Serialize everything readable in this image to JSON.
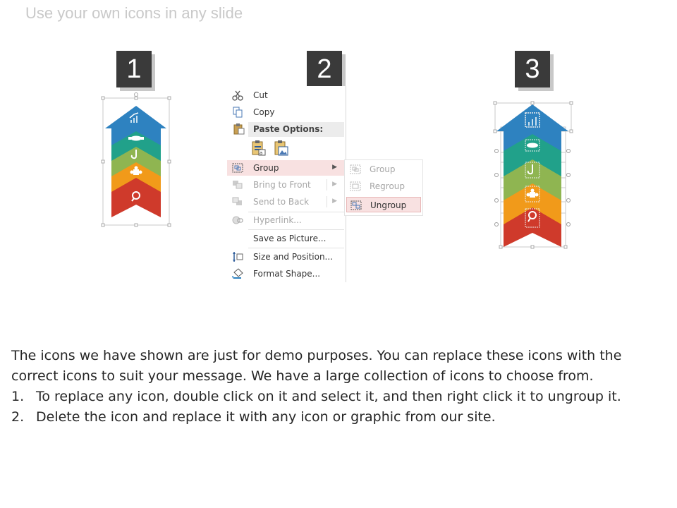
{
  "slide": {
    "title": "Use your own icons in any slide"
  },
  "steps": [
    "1",
    "2",
    "3"
  ],
  "arrow_colors": [
    "#2e82c0",
    "#21a18a",
    "#8fb551",
    "#f19a1a",
    "#cf3a2b"
  ],
  "arrow_icons": [
    "chart-growth-icon",
    "handshake-icon",
    "hook-icon",
    "puzzle-icon",
    "magnifier-icon"
  ],
  "context_menu": {
    "items": {
      "cut": "Cut",
      "copy": "Copy",
      "paste_options": "Paste Options:",
      "group": "Group",
      "bring_to_front": "Bring to Front",
      "send_to_back": "Send to Back",
      "hyperlink": "Hyperlink...",
      "save_as_picture": "Save as Picture...",
      "size_and_position": "Size and Position...",
      "format_shape": "Format Shape..."
    },
    "submenu": {
      "group": "Group",
      "regroup": "Regroup",
      "ungroup": "Ungroup"
    }
  },
  "instructions": {
    "intro": "The icons we have shown are just for demo purposes. You can replace these icons with the correct icons to suit your message. We have a large collection of icons to choose from.",
    "steps": [
      {
        "num": "1.",
        "text": "To replace any icon, double click on it and select it, and then right click it to ungroup it."
      },
      {
        "num": "2.",
        "text": "Delete the icon and replace it with any icon or graphic from our site."
      }
    ]
  }
}
